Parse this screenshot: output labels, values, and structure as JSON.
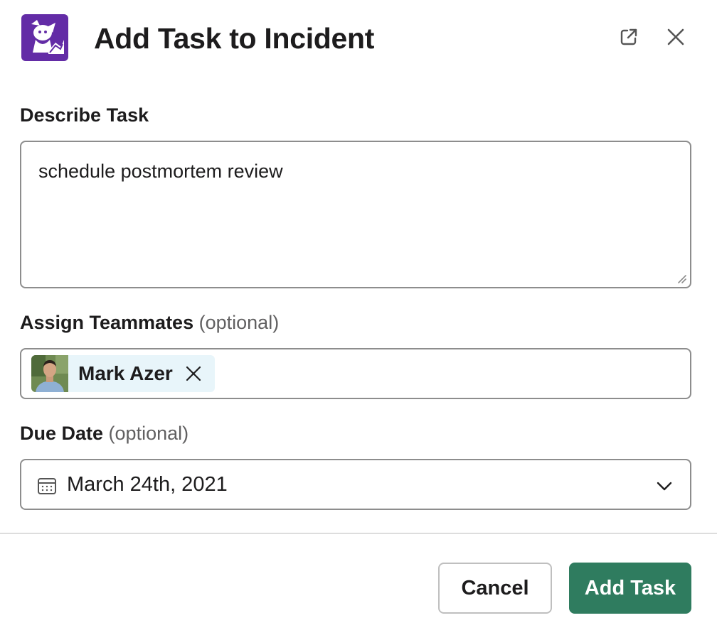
{
  "header": {
    "title": "Add Task to Incident",
    "logo_icon": "datadog-logo",
    "popout_icon": "external-link-icon",
    "close_icon": "close-icon"
  },
  "task": {
    "label": "Describe Task",
    "value": "schedule postmortem review"
  },
  "assignees": {
    "label": "Assign Teammates",
    "optional": "(optional)",
    "selected": [
      {
        "name": "Mark Azer"
      }
    ]
  },
  "due_date": {
    "label": "Due Date",
    "optional": "(optional)",
    "value": "March 24th, 2021"
  },
  "footer": {
    "cancel_label": "Cancel",
    "submit_label": "Add Task"
  },
  "colors": {
    "primary": "#2f7c5f",
    "brand": "#632ca6",
    "chip_bg": "#e8f5fa"
  }
}
